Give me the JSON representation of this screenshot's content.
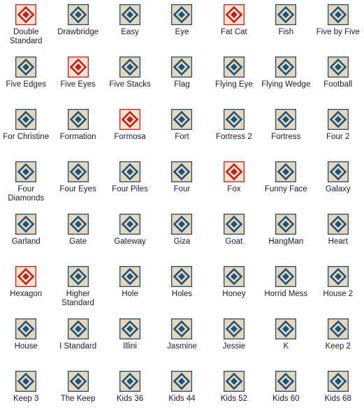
{
  "window": {
    "title": "Layout Gallery",
    "background_color": "#ffffff",
    "text_color": "#1b1b28"
  },
  "icon_styles": {
    "blue": {
      "name": "blue-diamond-icon",
      "border_color": "#1f5070",
      "fill_color": "#e8d7bd",
      "diamond_color": "#1d5378",
      "center_color": "#e8d7bd"
    },
    "red": {
      "name": "red-diamond-icon",
      "border_color": "#cc2027",
      "fill_color": "#f2e3cc",
      "diamond_color": "#c21d21",
      "center_color": "#f2e3cc"
    }
  },
  "grid": {
    "columns": 7,
    "rows": 8,
    "items": [
      {
        "label": "Double Standard",
        "style": "red"
      },
      {
        "label": "Drawbridge",
        "style": "blue"
      },
      {
        "label": "Easy",
        "style": "blue"
      },
      {
        "label": "Eye",
        "style": "blue"
      },
      {
        "label": "Fat Cat",
        "style": "red"
      },
      {
        "label": "Fish",
        "style": "blue"
      },
      {
        "label": "Five by Five",
        "style": "blue"
      },
      {
        "label": "Five Edges",
        "style": "blue"
      },
      {
        "label": "Five Eyes",
        "style": "red"
      },
      {
        "label": "Five Stacks",
        "style": "blue"
      },
      {
        "label": "Flag",
        "style": "blue"
      },
      {
        "label": "Flying Eye",
        "style": "blue"
      },
      {
        "label": "Flying Wedge",
        "style": "blue"
      },
      {
        "label": "Football",
        "style": "blue"
      },
      {
        "label": "For Christine",
        "style": "blue"
      },
      {
        "label": "Formation",
        "style": "blue"
      },
      {
        "label": "Formosa",
        "style": "red"
      },
      {
        "label": "Fort",
        "style": "blue"
      },
      {
        "label": "Fortress 2",
        "style": "blue"
      },
      {
        "label": "Fortress",
        "style": "blue"
      },
      {
        "label": "Four 2",
        "style": "blue"
      },
      {
        "label": "Four Diamonds",
        "style": "blue"
      },
      {
        "label": "Four Eyes",
        "style": "blue"
      },
      {
        "label": "Four Piles",
        "style": "blue"
      },
      {
        "label": "Four",
        "style": "blue"
      },
      {
        "label": "Fox",
        "style": "red"
      },
      {
        "label": "Funny Face",
        "style": "blue"
      },
      {
        "label": "Galaxy",
        "style": "blue"
      },
      {
        "label": "Garland",
        "style": "blue"
      },
      {
        "label": "Gate",
        "style": "blue"
      },
      {
        "label": "Gateway",
        "style": "blue"
      },
      {
        "label": "Giza",
        "style": "blue"
      },
      {
        "label": "Goat",
        "style": "blue"
      },
      {
        "label": "HangMan",
        "style": "blue"
      },
      {
        "label": "Heart",
        "style": "blue"
      },
      {
        "label": "Hexagon",
        "style": "red"
      },
      {
        "label": "Higher Standard",
        "style": "blue"
      },
      {
        "label": "Hole",
        "style": "blue"
      },
      {
        "label": "Holes",
        "style": "blue"
      },
      {
        "label": "Honey",
        "style": "blue"
      },
      {
        "label": "Horrid Mess",
        "style": "blue"
      },
      {
        "label": "House 2",
        "style": "blue"
      },
      {
        "label": "House",
        "style": "blue"
      },
      {
        "label": "I Standard",
        "style": "blue"
      },
      {
        "label": "Illini",
        "style": "blue"
      },
      {
        "label": "Jasmine",
        "style": "blue"
      },
      {
        "label": "Jessie",
        "style": "blue"
      },
      {
        "label": "K",
        "style": "blue"
      },
      {
        "label": "Keep 2",
        "style": "blue"
      },
      {
        "label": "Keep 3",
        "style": "blue"
      },
      {
        "label": "The Keep",
        "style": "blue"
      },
      {
        "label": "Kids 36",
        "style": "blue"
      },
      {
        "label": "Kids 44",
        "style": "blue"
      },
      {
        "label": "Kids 52",
        "style": "blue"
      },
      {
        "label": "Kids 60",
        "style": "blue"
      },
      {
        "label": "Kids 68",
        "style": "blue"
      }
    ]
  }
}
